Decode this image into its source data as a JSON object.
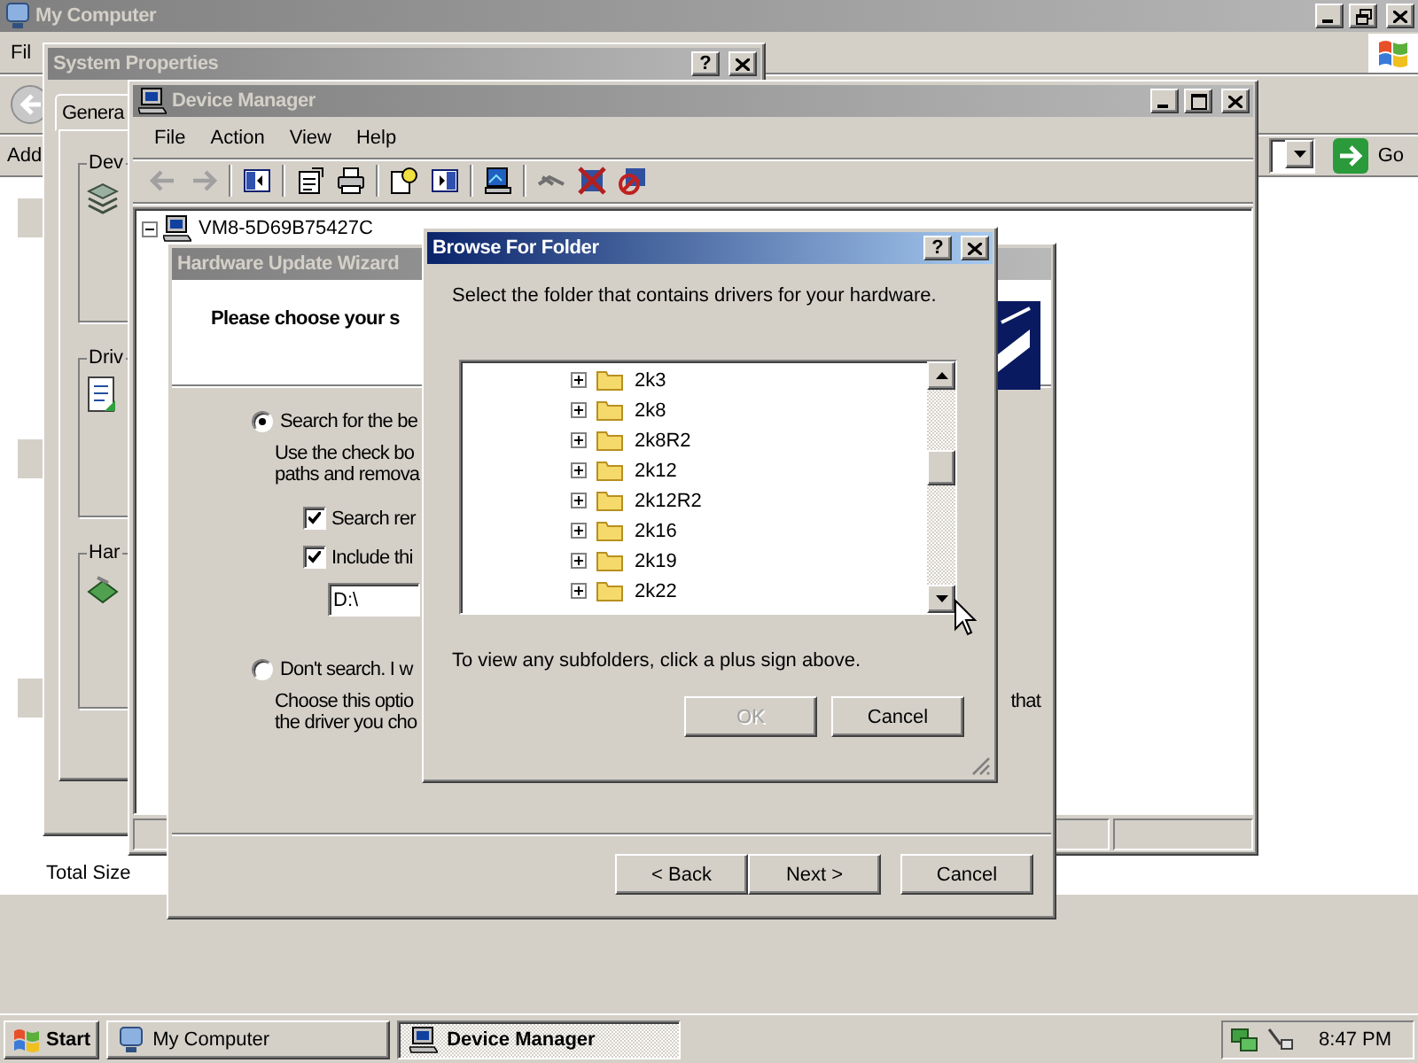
{
  "my_computer": {
    "title": "My Computer",
    "menu": [
      "Fil"
    ],
    "address_label": "Add",
    "go": "Go",
    "status": "Total Size"
  },
  "system_properties": {
    "title": "System Properties",
    "help_button": "?",
    "tabs": [
      {
        "label": "Genera",
        "selected": true
      }
    ],
    "groups": [
      "Dev",
      "Driv",
      "Har"
    ]
  },
  "device_manager": {
    "title": "Device Manager",
    "menu": [
      "File",
      "Action",
      "View",
      "Help"
    ],
    "tree": [
      {
        "label": "VM8-5D69B75427C",
        "expanded": true
      }
    ]
  },
  "wizard": {
    "title": "Hardware Update Wizard",
    "heading": "Please choose your s",
    "options": [
      {
        "label": "Search for the be",
        "selected": true,
        "description": [
          "Use the check bo",
          "paths and remova"
        ]
      },
      {
        "label": "Don't search. I w",
        "selected": false,
        "description": [
          "Choose this optio",
          "the driver you cho"
        ],
        "description_end": "that"
      }
    ],
    "checks": [
      {
        "label": "Search rer",
        "checked": true
      },
      {
        "label": "Include thi",
        "checked": true
      }
    ],
    "path": "D:\\",
    "buttons": [
      {
        "label": "< Back",
        "disabled": false
      },
      {
        "label": "Next >",
        "disabled": false
      },
      {
        "label": "Cancel",
        "disabled": false
      }
    ]
  },
  "browse": {
    "title": "Browse For Folder",
    "help_button": "?",
    "prompt": "Select the folder that contains drivers for your hardware.",
    "folders": [
      {
        "label": "2k3",
        "expanded": false
      },
      {
        "label": "2k8",
        "expanded": false
      },
      {
        "label": "2k8R2",
        "expanded": false
      },
      {
        "label": "2k12",
        "expanded": false
      },
      {
        "label": "2k12R2",
        "expanded": false
      },
      {
        "label": "2k16",
        "expanded": false
      },
      {
        "label": "2k19",
        "expanded": false
      },
      {
        "label": "2k22",
        "expanded": false
      }
    ],
    "hint": "To view any subfolders, click a plus sign above.",
    "buttons": [
      {
        "label": "OK",
        "disabled": true
      },
      {
        "label": "Cancel",
        "disabled": false
      }
    ]
  },
  "taskbar": {
    "start": "Start",
    "tasks": [
      {
        "label": "My Computer",
        "selected": false
      },
      {
        "label": "Device Manager",
        "selected": true
      }
    ],
    "clock": "8:47 PM"
  }
}
